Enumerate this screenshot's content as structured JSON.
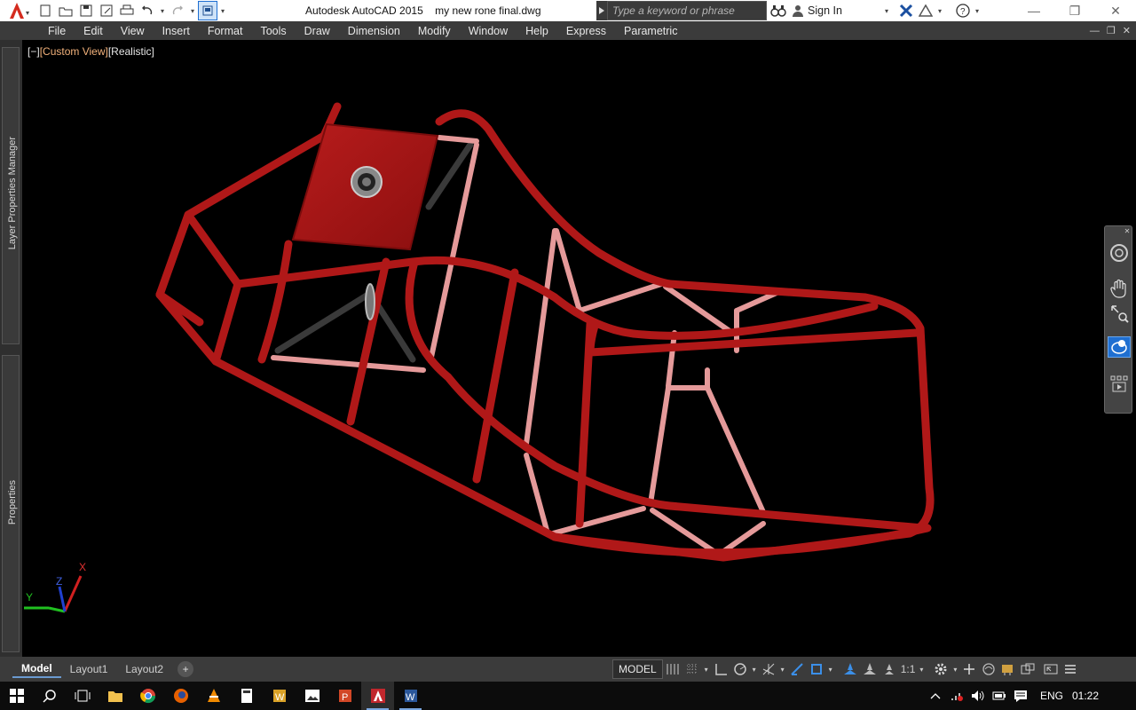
{
  "titlebar": {
    "app_name": "Autodesk AutoCAD 2015",
    "file_name": "my new rone final.dwg",
    "search_placeholder": "Type a keyword or phrase",
    "sign_in": "Sign In"
  },
  "menu": {
    "items": [
      "File",
      "Edit",
      "View",
      "Insert",
      "Format",
      "Tools",
      "Draw",
      "Dimension",
      "Modify",
      "Window",
      "Help",
      "Express",
      "Parametric"
    ]
  },
  "viewport": {
    "control": "[−]",
    "view": "[Custom View]",
    "style": "[Realistic]"
  },
  "palettes": {
    "layer_manager": "Layer Properties Manager",
    "properties": "Properties"
  },
  "ucs": {
    "x": "X",
    "y": "Y",
    "z": "Z"
  },
  "layout_tabs": [
    "Model",
    "Layout1",
    "Layout2"
  ],
  "statusbar": {
    "model": "MODEL",
    "scale": "1:1"
  },
  "taskbar": {
    "language": "ENG",
    "time": "01:22"
  },
  "colors": {
    "frame_tube": "#b01818",
    "brace_pink": "#e89a9a",
    "menu_bg": "#3b3b3b",
    "accent": "#1f6fd1"
  }
}
